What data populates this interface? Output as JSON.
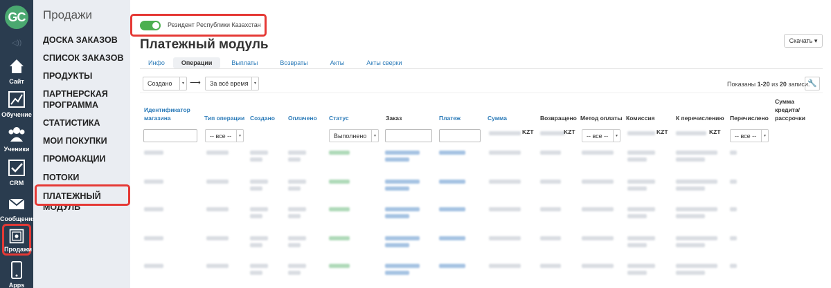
{
  "rail": {
    "logo": "GC",
    "items": [
      {
        "label": "Сайт",
        "icon": "home-icon"
      },
      {
        "label": "Обучение",
        "icon": "chart-icon"
      },
      {
        "label": "Ученики",
        "icon": "users-icon"
      },
      {
        "label": "CRM",
        "icon": "checkbox-icon"
      },
      {
        "label": "Сообщения",
        "icon": "mail-icon"
      },
      {
        "label": "Продажи",
        "icon": "safe-icon"
      },
      {
        "label": "Apps",
        "icon": "phone-icon"
      }
    ]
  },
  "menu": {
    "title": "Продажи",
    "items": [
      "Доска заказов",
      "Список заказов",
      "Продукты",
      "Партнерская программа",
      "Статистика",
      "Мои покупки",
      "Промоакции",
      "Потоки",
      "Платежный модуль"
    ]
  },
  "resident_toggle": {
    "label": "Резидент Республики Казахстан",
    "on": true
  },
  "page_title": "Платежный модуль",
  "download_label": "Скачать",
  "tabs": [
    "Инфо",
    "Операции",
    "Выплаты",
    "Возвраты",
    "Акты",
    "Акты сверки"
  ],
  "active_tab": "Операции",
  "filters": {
    "date_field": "Создано",
    "date_range": "За всё время"
  },
  "pagination": {
    "prefix": "Показаны",
    "range": "1-20",
    "middle": "из",
    "total": "20",
    "suffix": "записи."
  },
  "columns": [
    "Идентификатор магазина",
    "Тип операции",
    "Создано",
    "Оплачено",
    "Статус",
    "Заказ",
    "Платеж",
    "Сумма",
    "Возвращено",
    "Метод оплаты",
    "Комиссия",
    "К перечислению",
    "Перечислено",
    "Сумма кредита/ рассрочки"
  ],
  "column_filters": {
    "type": "-- все --",
    "status": "Выполнено",
    "method": "-- все --",
    "transferred": "-- все --",
    "currency": "KZT"
  },
  "colors": {
    "rail": "#2a3c4f",
    "menu": "#eaedf2",
    "accent_green": "#4caf50",
    "link_blue": "#2a7ab8",
    "highlight_red": "#e53935"
  }
}
